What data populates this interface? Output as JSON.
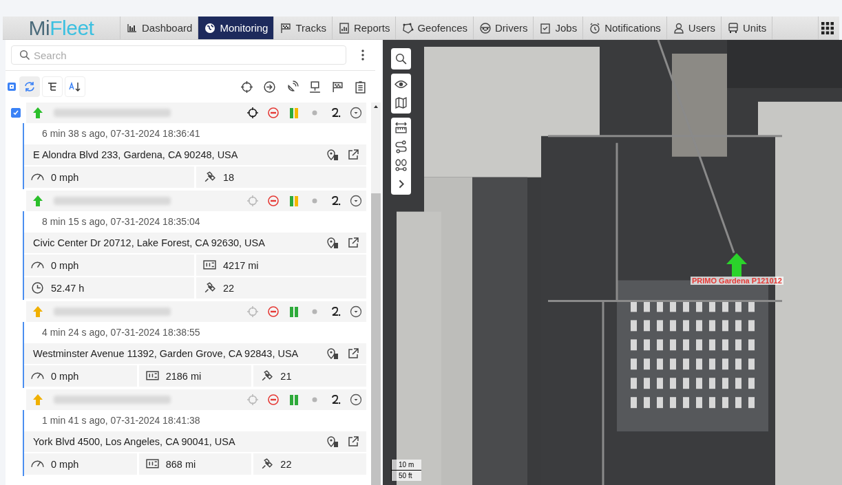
{
  "app": {
    "logo_parts": [
      "Mi",
      "Fleet"
    ]
  },
  "nav": [
    {
      "label": "Dashboard",
      "selected": false
    },
    {
      "label": "Monitoring",
      "selected": true
    },
    {
      "label": "Tracks",
      "selected": false
    },
    {
      "label": "Reports",
      "selected": false
    },
    {
      "label": "Geofences",
      "selected": false
    },
    {
      "label": "Drivers",
      "selected": false
    },
    {
      "label": "Jobs",
      "selected": false
    },
    {
      "label": "Notifications",
      "selected": false
    },
    {
      "label": "Users",
      "selected": false
    },
    {
      "label": "Units",
      "selected": false
    }
  ],
  "search": {
    "placeholder": "Search"
  },
  "toolbar": {
    "select_all_checked": true
  },
  "units": [
    {
      "checked": true,
      "kind": "active",
      "locate_active": true,
      "time": "6 min 38 s ago, 07-31-2024 18:36:41",
      "address": "E Alondra Blvd 233, Gardena, CA 90248, USA",
      "stat_rows": [
        [
          {
            "kind": "speed",
            "value": "0 mph"
          },
          {
            "kind": "satellites",
            "value": "18"
          }
        ]
      ]
    },
    {
      "checked": false,
      "kind": "active",
      "locate_active": false,
      "time": "8 min 15 s ago, 07-31-2024 18:35:04",
      "address": "Civic Center Dr 20712, Lake Forest, CA 92630, USA",
      "stat_rows": [
        [
          {
            "kind": "speed",
            "value": "0 mph"
          },
          {
            "kind": "odometer",
            "value": "4217 mi"
          }
        ],
        [
          {
            "kind": "hours",
            "value": "52.47 h"
          },
          {
            "kind": "satellites",
            "value": "22"
          }
        ]
      ]
    },
    {
      "checked": false,
      "kind": "idle",
      "locate_active": false,
      "time": "4 min 24 s ago, 07-31-2024 18:38:55",
      "address": "Westminster Avenue 11392, Garden Grove, CA 92843, USA",
      "stat_rows": [
        [
          {
            "kind": "speed",
            "value": "0 mph"
          },
          {
            "kind": "odometer",
            "value": "2186 mi"
          },
          {
            "kind": "satellites",
            "value": "21"
          }
        ]
      ]
    },
    {
      "checked": false,
      "kind": "idle",
      "locate_active": false,
      "time": "1 min 41 s ago, 07-31-2024 18:41:38",
      "address": "York Blvd 4500, Los Angeles, CA 90041, USA",
      "stat_rows": [
        [
          {
            "kind": "speed",
            "value": "0 mph"
          },
          {
            "kind": "odometer",
            "value": "868 mi"
          },
          {
            "kind": "satellites",
            "value": "22"
          }
        ]
      ]
    }
  ],
  "map": {
    "marker_label": "PRIMO Gardena P121012",
    "scale_metric": "10 m",
    "scale_imperial": "50 ft"
  }
}
